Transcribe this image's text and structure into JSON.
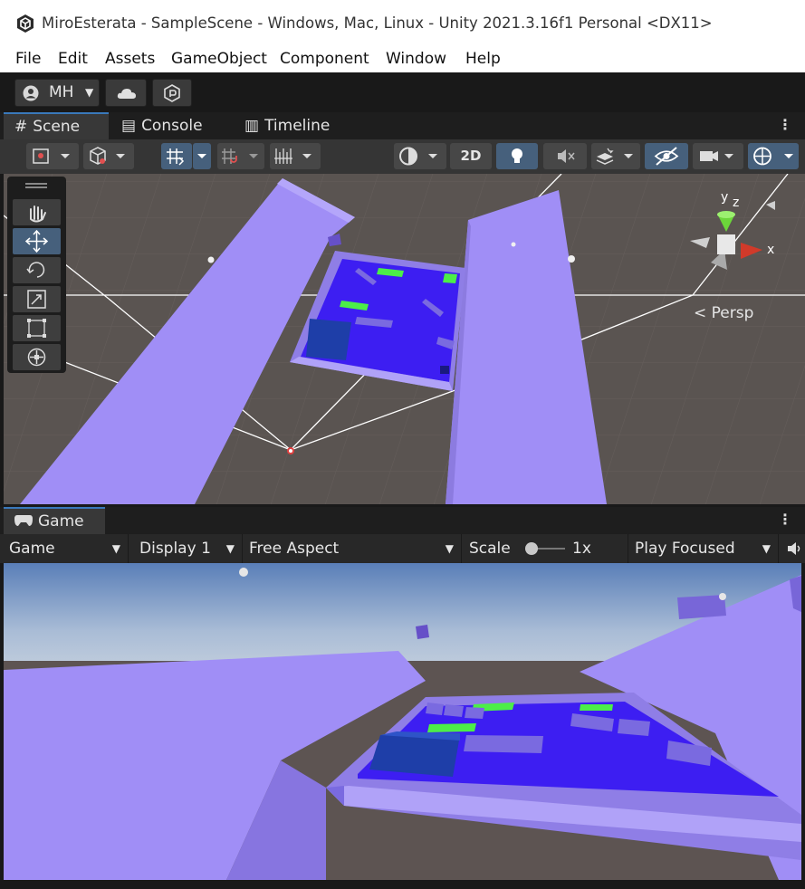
{
  "window": {
    "title": "MiroEsterata - SampleScene - Windows, Mac, Linux - Unity 2021.3.16f1 Personal <DX11>"
  },
  "menu": [
    "File",
    "Edit",
    "Assets",
    "GameObject",
    "Component",
    "Window",
    "Help"
  ],
  "toolbar": {
    "account_label": "MH"
  },
  "scene_tabs": [
    {
      "label": "Scene",
      "icon": "hash-icon"
    },
    {
      "label": "Console",
      "icon": "console-icon"
    },
    {
      "label": "Timeline",
      "icon": "film-icon"
    }
  ],
  "scene_toolbar": {
    "mode_2d": "2D"
  },
  "scene": {
    "gizmo": {
      "y_label": "y",
      "z_label": "z",
      "x_label": "x"
    },
    "projection_label": "Persp"
  },
  "game_tab": {
    "label": "Game",
    "icon": "gamepad-icon"
  },
  "game_toolbar": {
    "view": "Game",
    "display": "Display 1",
    "aspect": "Free Aspect",
    "scale_label": "Scale",
    "scale_value": "1x",
    "play_mode": "Play Focused"
  },
  "colors": {
    "accent": "#3a79bb",
    "platform": "#a08ef6",
    "board": "#3d1ef2",
    "scene_bg": "#595350"
  }
}
